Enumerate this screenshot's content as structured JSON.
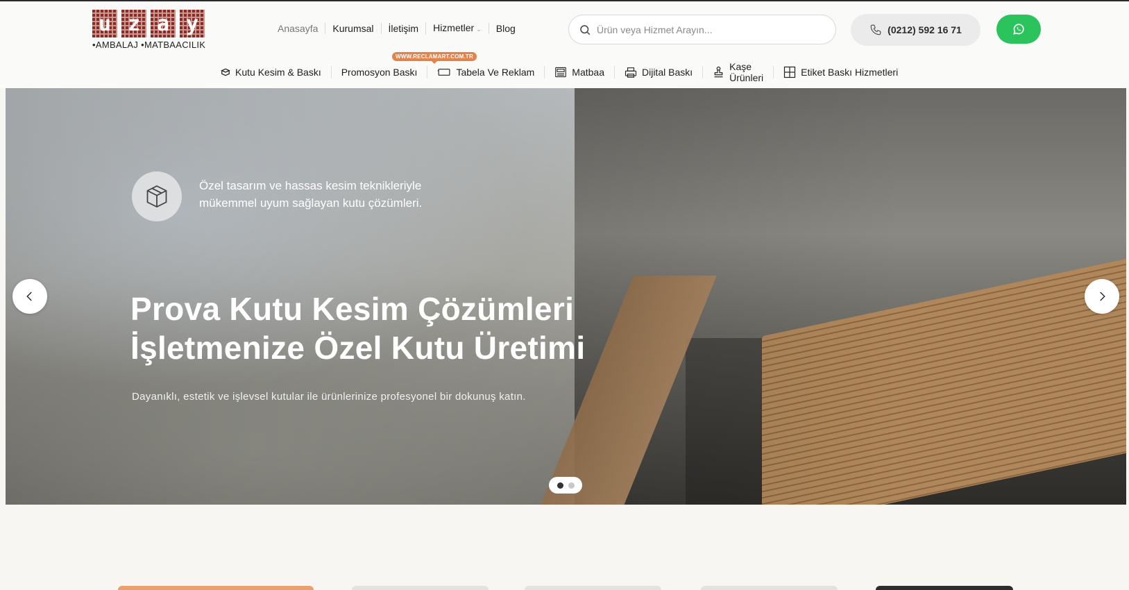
{
  "header": {
    "logo": {
      "letters": [
        "u",
        "z",
        "a",
        "y"
      ],
      "tagline": "•AMBALAJ •MATBAACILIK",
      "color": "#8e2a22"
    },
    "nav": [
      {
        "label": "Anasayfa"
      },
      {
        "label": "Kurumsal"
      },
      {
        "label": "İletişim"
      },
      {
        "label": "Hizmetler",
        "has_dropdown": true
      },
      {
        "label": "Blog"
      }
    ],
    "search": {
      "placeholder": "Ürün veya Hizmet Arayın...",
      "icon": "search-icon"
    },
    "phone": {
      "label": "(0212) 592 16 71",
      "icon": "phone-icon"
    },
    "whatsapp": {
      "icon": "whatsapp-icon",
      "color": "#2bc35c"
    }
  },
  "categories": {
    "badge": "WWW.RECLAMART.COM.TR",
    "items": [
      {
        "label": "Kutu Kesim & Baskı",
        "icon": "box-icon"
      },
      {
        "label": "Promosyon Baskı",
        "icon": ""
      },
      {
        "label": "Tabela Ve Reklam",
        "icon": "signboard-icon"
      },
      {
        "label": "Matbaa",
        "icon": "press-icon"
      },
      {
        "label": "Dijital Baskı",
        "icon": "printer-icon"
      },
      {
        "label_line1": "Kaşe",
        "label_line2": "Ürünleri",
        "icon": "stamp-icon"
      },
      {
        "label": "Etiket Baskı Hizmetleri",
        "icon": "grid-icon"
      }
    ]
  },
  "hero": {
    "subtitle": "Özel tasarım ve hassas kesim teknikleriyle mükemmel uyum sağlayan kutu çözümleri.",
    "title_line1": "Prova Kutu Kesim Çözümleri",
    "title_line2": "İşletmenize Özel Kutu Üretimi",
    "description": "Dayanıklı, estetik ve işlevsel kutular ile ürünlerinize profesyonel bir dokunuş katın.",
    "slides_total": 2,
    "active_slide": 1
  }
}
